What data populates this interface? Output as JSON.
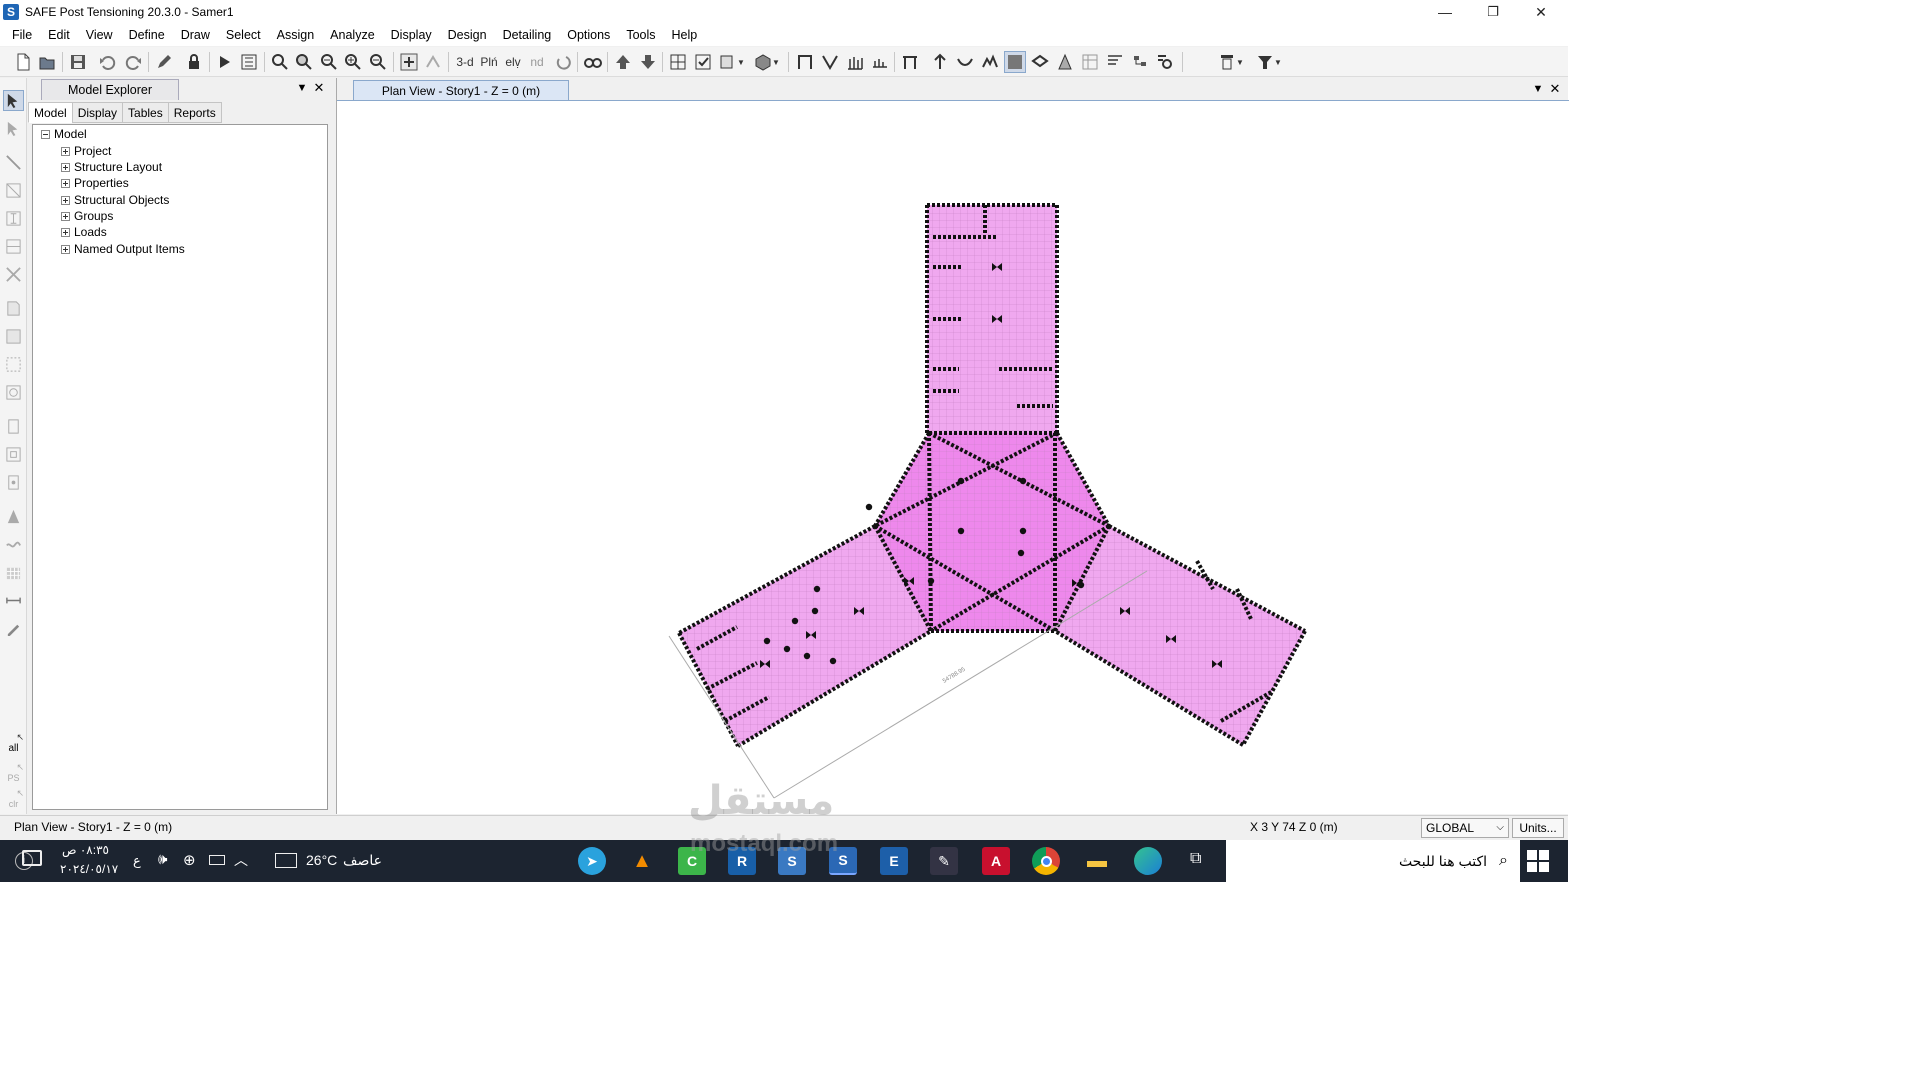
{
  "window": {
    "title": "SAFE Post Tensioning 20.3.0 - Samer1",
    "icon": "S",
    "minimize": "—",
    "restore": "❐",
    "close": "✕"
  },
  "menu": [
    "File",
    "Edit",
    "View",
    "Define",
    "Draw",
    "Select",
    "Assign",
    "Analyze",
    "Display",
    "Design",
    "Detailing",
    "Options",
    "Tools",
    "Help"
  ],
  "toolbar": {
    "view_3d": "3-d",
    "plan_view": "Plń",
    "elevation_view": "elṿ",
    "nd": "nd"
  },
  "explorer": {
    "title": "Model Explorer",
    "dropdown": "▼",
    "close": "✕",
    "tabs": [
      "Model",
      "Display",
      "Tables",
      "Reports"
    ],
    "tree": {
      "root": "Model",
      "children": [
        "Project",
        "Structure Layout",
        "Properties",
        "Structural Objects",
        "Groups",
        "Loads",
        "Named Output Items"
      ]
    }
  },
  "left_toolbar": {
    "all": "all",
    "ps": "PS",
    "clr": "clr"
  },
  "plan": {
    "tab_title": "Plan View - Story1 - Z = 0 (m)",
    "dimension_label": "54788.95",
    "slab_color": "#f0a8ef",
    "core_color": "#ee88ec",
    "dropdown": "▼",
    "close": "✕"
  },
  "status": {
    "view": "Plan View - Story1 - Z = 0 (m)",
    "coords": "X 3  Y 74  Z 0 (m)",
    "coord_system": "GLOBAL",
    "units": "Units..."
  },
  "taskbar": {
    "time": "٠٨:٣٥ ص",
    "date": "٢٠٢٤/٠٥/١٧",
    "lang": "ع",
    "weather_temp": "26°C",
    "weather_desc": "عاصف",
    "search_placeholder": "اكتب هنا للبحث",
    "info": "i",
    "apps": [
      "telegram",
      "vlc",
      "camtasia",
      "revit",
      "safe-old",
      "safe",
      "etabs",
      "sketch",
      "autocad",
      "chrome",
      "explorer",
      "edge"
    ],
    "watermark": "mostaql.com",
    "watermark_ar": "مستقل"
  }
}
